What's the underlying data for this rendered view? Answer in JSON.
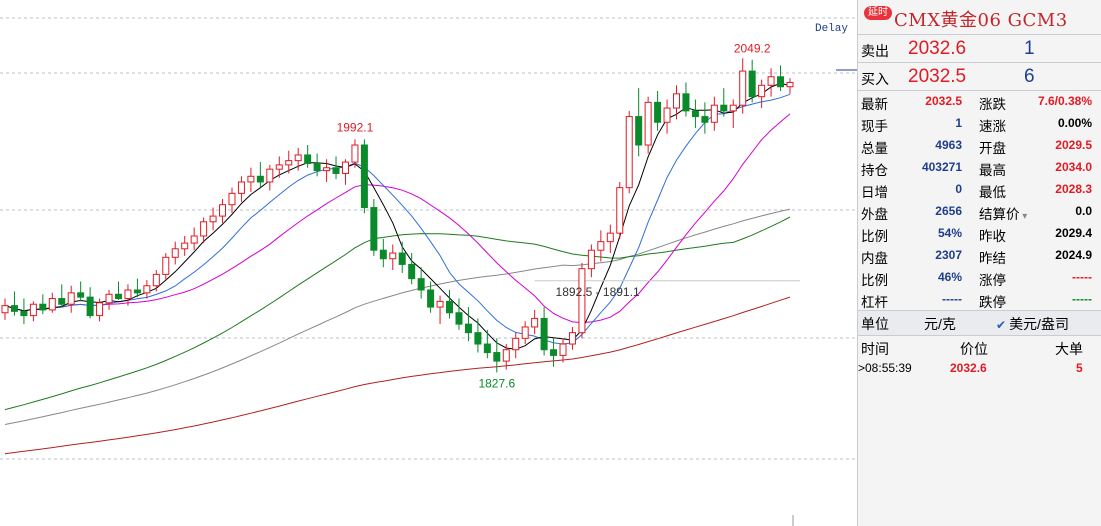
{
  "chart": {
    "delay_label": "Delay",
    "annotations": {
      "high_1": "1992.1",
      "high_2": "2049.2",
      "low_1": "1827.6",
      "gap": "1892.5 - 1891.1"
    }
  },
  "chart_data": {
    "type": "candlestick",
    "annotations": [
      "1992.1",
      "2049.2",
      "1827.6",
      "1892.5 - 1891.1"
    ],
    "candles": [
      [
        1870,
        1880,
        1865,
        1875
      ],
      [
        1875,
        1885,
        1868,
        1871
      ],
      [
        1871,
        1880,
        1862,
        1868
      ],
      [
        1868,
        1878,
        1864,
        1876
      ],
      [
        1876,
        1883,
        1869,
        1872
      ],
      [
        1872,
        1884,
        1870,
        1880
      ],
      [
        1880,
        1890,
        1874,
        1876
      ],
      [
        1876,
        1889,
        1870,
        1884
      ],
      [
        1884,
        1892,
        1878,
        1881
      ],
      [
        1881,
        1888,
        1866,
        1868
      ],
      [
        1868,
        1880,
        1864,
        1877
      ],
      [
        1877,
        1886,
        1872,
        1883
      ],
      [
        1883,
        1892,
        1879,
        1880
      ],
      [
        1880,
        1890,
        1875,
        1886
      ],
      [
        1886,
        1894,
        1881,
        1884
      ],
      [
        1884,
        1893,
        1880,
        1889
      ],
      [
        1889,
        1900,
        1885,
        1897
      ],
      [
        1897,
        1912,
        1893,
        1909
      ],
      [
        1909,
        1920,
        1904,
        1915
      ],
      [
        1915,
        1924,
        1910,
        1919
      ],
      [
        1919,
        1930,
        1914,
        1924
      ],
      [
        1924,
        1937,
        1919,
        1934
      ],
      [
        1934,
        1944,
        1928,
        1938
      ],
      [
        1938,
        1950,
        1933,
        1946
      ],
      [
        1946,
        1958,
        1940,
        1954
      ],
      [
        1954,
        1966,
        1948,
        1962
      ],
      [
        1962,
        1972,
        1955,
        1966
      ],
      [
        1966,
        1976,
        1958,
        1962
      ],
      [
        1962,
        1974,
        1956,
        1971
      ],
      [
        1971,
        1980,
        1965,
        1974
      ],
      [
        1974,
        1984,
        1968,
        1977
      ],
      [
        1977,
        1986,
        1970,
        1981
      ],
      [
        1981,
        1988,
        1972,
        1975
      ],
      [
        1975,
        1982,
        1966,
        1970
      ],
      [
        1970,
        1978,
        1962,
        1972
      ],
      [
        1972,
        1980,
        1964,
        1968
      ],
      [
        1968,
        1978,
        1960,
        1976
      ],
      [
        1976,
        1992,
        1972,
        1988
      ],
      [
        1988,
        1992,
        1940,
        1944
      ],
      [
        1944,
        1950,
        1910,
        1914
      ],
      [
        1914,
        1922,
        1902,
        1908
      ],
      [
        1908,
        1918,
        1900,
        1912
      ],
      [
        1912,
        1920,
        1898,
        1904
      ],
      [
        1904,
        1912,
        1890,
        1894
      ],
      [
        1894,
        1902,
        1880,
        1886
      ],
      [
        1886,
        1892,
        1870,
        1874
      ],
      [
        1874,
        1882,
        1862,
        1878
      ],
      [
        1878,
        1886,
        1866,
        1870
      ],
      [
        1870,
        1880,
        1858,
        1862
      ],
      [
        1862,
        1874,
        1850,
        1856
      ],
      [
        1856,
        1866,
        1842,
        1848
      ],
      [
        1848,
        1858,
        1838,
        1842
      ],
      [
        1842,
        1852,
        1828,
        1836
      ],
      [
        1836,
        1848,
        1830,
        1844
      ],
      [
        1844,
        1856,
        1838,
        1852
      ],
      [
        1852,
        1864,
        1848,
        1860
      ],
      [
        1860,
        1872,
        1855,
        1866
      ],
      [
        1866,
        1874,
        1840,
        1844
      ],
      [
        1844,
        1852,
        1832,
        1840
      ],
      [
        1840,
        1852,
        1835,
        1848
      ],
      [
        1848,
        1860,
        1844,
        1856
      ],
      [
        1856,
        1905,
        1852,
        1901
      ],
      [
        1901,
        1918,
        1895,
        1914
      ],
      [
        1914,
        1928,
        1906,
        1920
      ],
      [
        1920,
        1932,
        1912,
        1926
      ],
      [
        1926,
        1962,
        1922,
        1958
      ],
      [
        1958,
        2012,
        1954,
        2008
      ],
      [
        2008,
        2028,
        1980,
        1988
      ],
      [
        1988,
        2022,
        1982,
        2018
      ],
      [
        2018,
        2026,
        1998,
        2004
      ],
      [
        2004,
        2020,
        1996,
        2014
      ],
      [
        2014,
        2030,
        2006,
        2024
      ],
      [
        2024,
        2032,
        2008,
        2012
      ],
      [
        2012,
        2020,
        2000,
        2008
      ],
      [
        2008,
        2018,
        1996,
        2004
      ],
      [
        2004,
        2022,
        1998,
        2016
      ],
      [
        2016,
        2028,
        2008,
        2012
      ],
      [
        2012,
        2020,
        2000,
        2016
      ],
      [
        2016,
        2049,
        2010,
        2040
      ],
      [
        2040,
        2048,
        2018,
        2022
      ],
      [
        2022,
        2034,
        2014,
        2030
      ],
      [
        2030,
        2042,
        2022,
        2036
      ],
      [
        2036,
        2044,
        2026,
        2029
      ],
      [
        2029,
        2035,
        2024,
        2032
      ]
    ]
  },
  "panel": {
    "badge": "延时",
    "title": "CMX黄金06  GCM3",
    "sell_label": "卖出",
    "sell_price": "2032.6",
    "sell_vol": "1",
    "buy_label": "买入",
    "buy_price": "2032.5",
    "buy_vol": "6",
    "stats": [
      {
        "l1": "最新",
        "v1": "2032.5",
        "c1": "red",
        "l2": "涨跌",
        "v2": "7.6/0.38%",
        "c2": "red"
      },
      {
        "l1": "现手",
        "v1": "1",
        "c1": "blue",
        "l2": "速涨",
        "v2": "0.00%",
        "c2": "blk"
      },
      {
        "l1": "总量",
        "v1": "4963",
        "c1": "blue",
        "l2": "开盘",
        "v2": "2029.5",
        "c2": "red"
      },
      {
        "l1": "持仓",
        "v1": "403271",
        "c1": "blue",
        "l2": "最高",
        "v2": "2034.0",
        "c2": "red"
      },
      {
        "l1": "日增",
        "v1": "0",
        "c1": "blue",
        "l2": "最低",
        "v2": "2028.3",
        "c2": "red"
      },
      {
        "l1": "外盘",
        "v1": "2656",
        "c1": "blue",
        "l2": "结算价",
        "v2": "0.0",
        "c2": "blk"
      },
      {
        "l1": "比例",
        "v1": "54%",
        "c1": "blue",
        "l2": "昨收",
        "v2": "2029.4",
        "c2": "blk"
      },
      {
        "l1": "内盘",
        "v1": "2307",
        "c1": "blue",
        "l2": "昨结",
        "v2": "2024.9",
        "c2": "blk"
      },
      {
        "l1": "比例",
        "v1": "46%",
        "c1": "blue",
        "l2": "涨停",
        "v2": "-----",
        "c2": "red"
      },
      {
        "l1": "杠杆",
        "v1": "-----",
        "c1": "blue",
        "l2": "跌停",
        "v2": "-----",
        "c2": "grn"
      }
    ],
    "unit_label": "单位",
    "unit_value": "元/克",
    "unit_option": "美元/盎司",
    "tick_headers": {
      "time": "时间",
      "price": "价位",
      "big": "大单"
    },
    "ticks": [
      {
        "time": "08:55:39",
        "price": "2032.6",
        "big": "5"
      }
    ]
  }
}
